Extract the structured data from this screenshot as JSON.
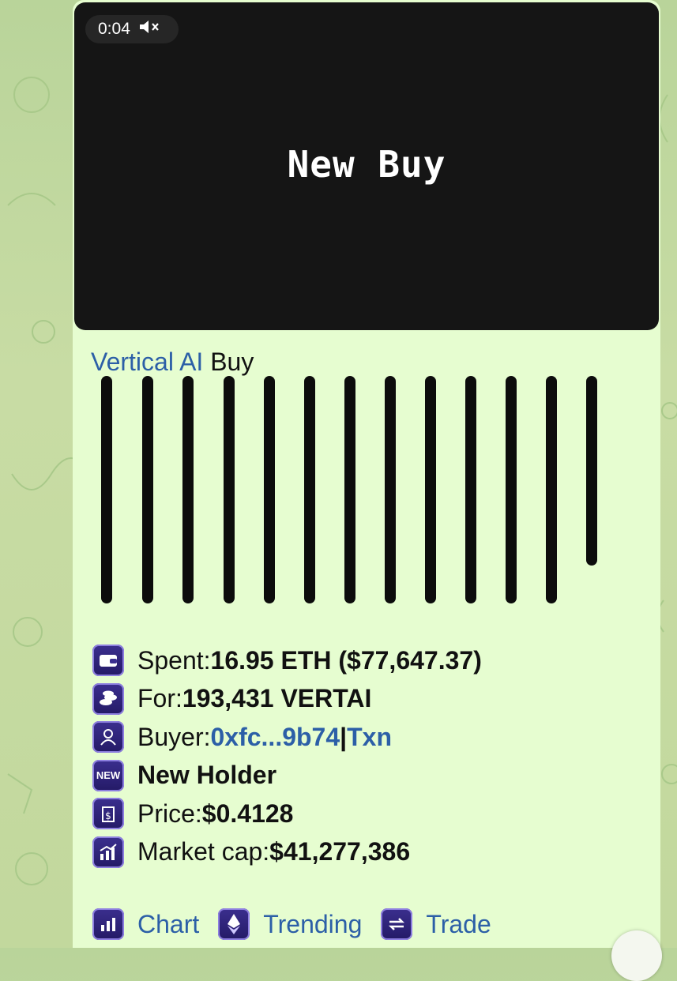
{
  "video": {
    "timestamp": "0:04",
    "mute_icon": "speaker-muted-icon",
    "title": "New Buy"
  },
  "message": {
    "token_link": "Vertical AI",
    "action": " Buy",
    "rows": [
      {
        "icon": "wallet-icon",
        "label": "Spent: ",
        "value": "16.95 ETH ($77,647.37)"
      },
      {
        "icon": "coins-icon",
        "label": "For: ",
        "value": "193,431 VERTAI"
      },
      {
        "icon": "user-icon",
        "label": "Buyer: ",
        "link": "0xfc...9b74",
        "sep": " | ",
        "link2": "Txn"
      },
      {
        "icon": "new-badge-icon",
        "value": "New Holder"
      },
      {
        "icon": "price-tag-icon",
        "label": "Price: ",
        "value": "$0.4128"
      },
      {
        "icon": "chart-growth-icon",
        "label": "Market cap: ",
        "value": "$41,277,386"
      }
    ],
    "footer": [
      {
        "icon": "bar-chart-icon",
        "label": "Chart"
      },
      {
        "icon": "ethereum-icon",
        "label": "Trending"
      },
      {
        "icon": "swap-icon",
        "label": "Trade"
      }
    ]
  },
  "colors": {
    "link": "#2c5fa7",
    "bubble": "#e6fdd0",
    "icon_bg": "#2e2478"
  }
}
